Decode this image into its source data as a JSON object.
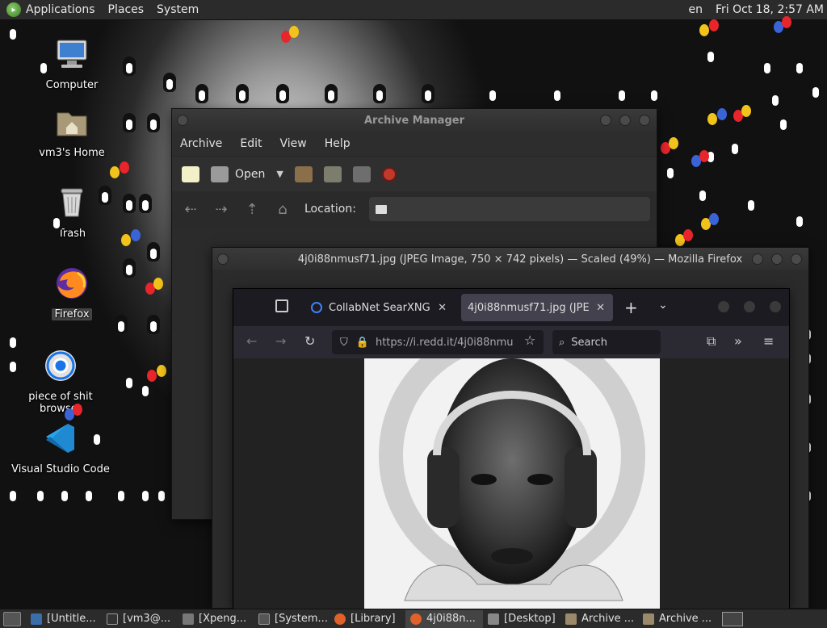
{
  "top_panel": {
    "menus": [
      "Applications",
      "Places",
      "System"
    ],
    "keyboard_layout": "en",
    "clock": "Fri Oct 18,  2:57 AM"
  },
  "desktop_icons": [
    {
      "label": "Computer",
      "icon": "computer-icon"
    },
    {
      "label": "vm3's Home",
      "icon": "home-folder-icon"
    },
    {
      "label": "Trash",
      "icon": "trash-icon"
    },
    {
      "label": "Firefox",
      "icon": "firefox-icon"
    },
    {
      "label": "piece of shit browser",
      "icon": "chrome-icon"
    },
    {
      "label": "Visual Studio Code",
      "icon": "vscode-icon"
    }
  ],
  "archive_manager": {
    "title": "Archive Manager",
    "menus": [
      "Archive",
      "Edit",
      "View",
      "Help"
    ],
    "toolbar": {
      "open_label": "Open"
    },
    "location_label": "Location:"
  },
  "firefox": {
    "title": "4j0i88nmusf71.jpg (JPEG Image, 750 × 742 pixels) — Scaled (49%) — Mozilla Firefox",
    "tabs": [
      {
        "label": "CollabNet SearXNG",
        "active": false
      },
      {
        "label": "4j0i88nmusf71.jpg (JPEG I",
        "active": true
      }
    ],
    "url": "https://i.redd.it/4j0i88nmu",
    "search_placeholder": "Search"
  },
  "taskbar": {
    "tasks": [
      {
        "label": "[Untitle...",
        "active": false
      },
      {
        "label": "[vm3@...",
        "active": false
      },
      {
        "label": "[Xpeng...",
        "active": false
      },
      {
        "label": "[System...",
        "active": false
      },
      {
        "label": "[Library]",
        "active": false
      },
      {
        "label": "4j0i88n...",
        "active": true
      },
      {
        "label": "[Desktop]",
        "active": false
      },
      {
        "label": "Archive ...",
        "active": false
      },
      {
        "label": "Archive ...",
        "active": false
      }
    ]
  }
}
